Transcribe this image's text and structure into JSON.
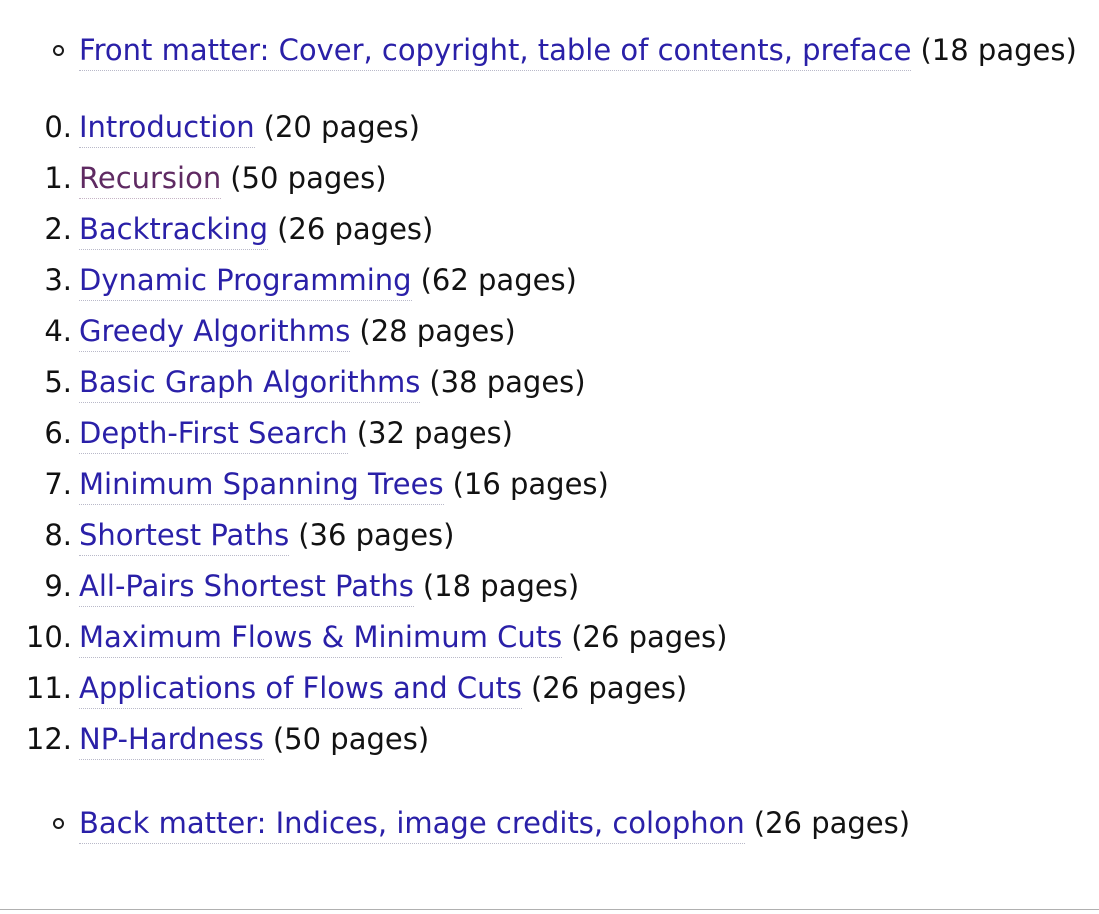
{
  "document": {
    "front_matter": {
      "marker": "circle-bullet",
      "link_text": "Front matter: Cover, copyright, table of contents, preface",
      "pages": "(18 pages)",
      "visited": false
    },
    "chapters": [
      {
        "number": "0.",
        "link_text": "Introduction",
        "pages": "(20 pages)",
        "visited": false
      },
      {
        "number": "1.",
        "link_text": "Recursion",
        "pages": "(50 pages)",
        "visited": true
      },
      {
        "number": "2.",
        "link_text": "Backtracking",
        "pages": "(26 pages)",
        "visited": false
      },
      {
        "number": "3.",
        "link_text": "Dynamic Programming",
        "pages": "(62 pages)",
        "visited": false
      },
      {
        "number": "4.",
        "link_text": "Greedy Algorithms",
        "pages": "(28 pages)",
        "visited": false
      },
      {
        "number": "5.",
        "link_text": "Basic Graph Algorithms",
        "pages": "(38 pages)",
        "visited": false
      },
      {
        "number": "6.",
        "link_text": "Depth-First Search",
        "pages": "(32 pages)",
        "visited": false
      },
      {
        "number": "7.",
        "link_text": "Minimum Spanning Trees",
        "pages": "(16 pages)",
        "visited": false
      },
      {
        "number": "8.",
        "link_text": "Shortest Paths",
        "pages": "(36 pages)",
        "visited": false
      },
      {
        "number": "9.",
        "link_text": "All-Pairs Shortest Paths",
        "pages": "(18 pages)",
        "visited": false
      },
      {
        "number": "10.",
        "link_text": "Maximum Flows & Minimum Cuts",
        "pages": "(26 pages)",
        "visited": false
      },
      {
        "number": "11.",
        "link_text": "Applications of Flows and Cuts",
        "pages": "(26 pages)",
        "visited": false
      },
      {
        "number": "12.",
        "link_text": "NP-Hardness",
        "pages": "(50 pages)",
        "visited": false
      }
    ],
    "back_matter": {
      "marker": "circle-bullet",
      "link_text": "Back matter: Indices, image credits, colophon",
      "pages": "(26 pages)",
      "visited": false
    }
  },
  "colors": {
    "link": "#2a20a8",
    "link_visited": "#5f2a62",
    "text": "#121212",
    "underline_dots": "#b9b9c9",
    "background": "#ffffff",
    "bottom_rule": "#b0b0b0"
  }
}
